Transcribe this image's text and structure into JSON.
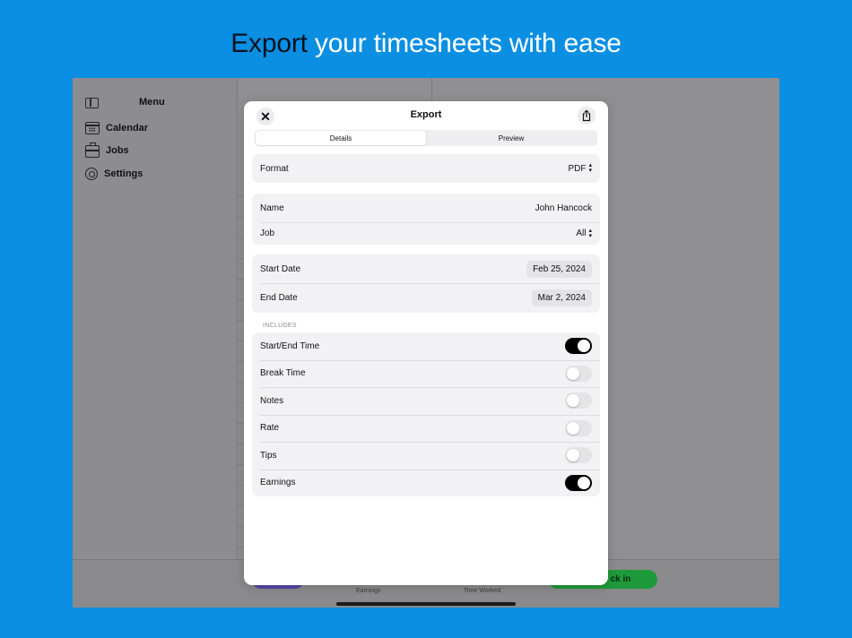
{
  "headline": {
    "dark": "Export",
    "light": " your timesheets with ease"
  },
  "sidebar": {
    "title": "Menu",
    "items": [
      {
        "label": "Calendar",
        "icon": "calendar-icon"
      },
      {
        "label": "Jobs",
        "icon": "briefcase-icon"
      },
      {
        "label": "Settings",
        "icon": "gear-icon"
      }
    ]
  },
  "bottom_bar": {
    "earnings_label": "Earnings",
    "time_worked_label": "Time Worked",
    "clock_in_label": "ck in"
  },
  "modal": {
    "title": "Export",
    "close_icon": "close-icon",
    "share_icon": "share-icon",
    "tabs": [
      {
        "label": "Details",
        "active": true
      },
      {
        "label": "Preview",
        "active": false
      }
    ],
    "format": {
      "label": "Format",
      "value": "PDF"
    },
    "name": {
      "label": "Name",
      "value": "John Hancock"
    },
    "job": {
      "label": "Job",
      "value": "All"
    },
    "start_date": {
      "label": "Start Date",
      "value": "Feb 25, 2024"
    },
    "end_date": {
      "label": "End Date",
      "value": "Mar 2, 2024"
    },
    "includes_header": "INCLUDES",
    "includes": [
      {
        "label": "Start/End Time",
        "on": true
      },
      {
        "label": "Break Time",
        "on": false
      },
      {
        "label": "Notes",
        "on": false
      },
      {
        "label": "Rate",
        "on": false
      },
      {
        "label": "Tips",
        "on": false
      },
      {
        "label": "Earnings",
        "on": true
      }
    ]
  },
  "colors": {
    "background": "#0a8fe3",
    "toggle_on": "#000000",
    "clock_in": "#1f9a3a"
  }
}
